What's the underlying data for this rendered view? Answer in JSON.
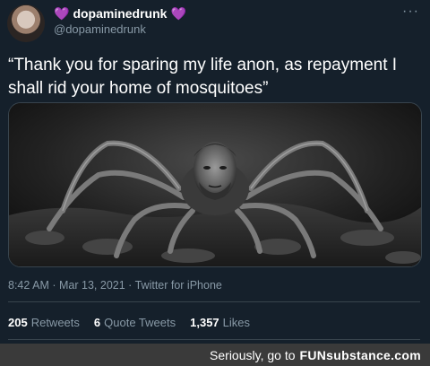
{
  "author": {
    "display_name": "dopaminedrunk",
    "handle": "@dopaminedrunk",
    "heart_glyph": "💜",
    "heart_color": "#9b6bcf"
  },
  "menu_glyph": "···",
  "tweet": {
    "text": "“Thank you for sparing my life anon, as repayment I shall rid your home of mosquitoes”",
    "media_icon": "spider-with-human-face-image"
  },
  "meta": {
    "time": "8:42 AM",
    "separator": "·",
    "date": "Mar 13, 2021",
    "source": "Twitter for iPhone"
  },
  "stats": {
    "retweets": {
      "count": "205",
      "label": "Retweets"
    },
    "quote_tweets": {
      "count": "6",
      "label": "Quote Tweets"
    },
    "likes": {
      "count": "1,357",
      "label": "Likes"
    }
  },
  "footer": {
    "text": "Seriously, go to",
    "brand": "FUNsubstance.com"
  },
  "colors": {
    "background": "#15202b",
    "secondary_text": "#8899a6",
    "divider": "#38444d",
    "footer_bg": "#3a3a3a"
  }
}
